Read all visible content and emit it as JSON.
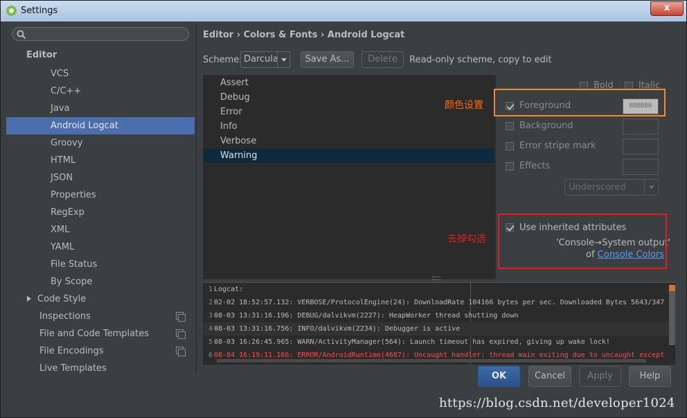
{
  "window": {
    "title": "Settings",
    "close_label": "x"
  },
  "sidebar": {
    "search_placeholder": "",
    "section": "Editor",
    "items": [
      {
        "label": "VCS"
      },
      {
        "label": "C/C++"
      },
      {
        "label": "Java"
      },
      {
        "label": "Android Logcat",
        "selected": true
      },
      {
        "label": "Groovy"
      },
      {
        "label": "HTML"
      },
      {
        "label": "JSON"
      },
      {
        "label": "Properties"
      },
      {
        "label": "RegExp"
      },
      {
        "label": "XML"
      },
      {
        "label": "YAML"
      },
      {
        "label": "File Status"
      },
      {
        "label": "By Scope"
      }
    ],
    "top_items": [
      {
        "label": "Code Style"
      },
      {
        "label": "Inspections"
      },
      {
        "label": "File and Code Templates"
      },
      {
        "label": "File Encodings"
      },
      {
        "label": "Live Templates"
      }
    ]
  },
  "breadcrumb": "Editor › Colors & Fonts › Android Logcat",
  "scheme": {
    "label": "Scheme:",
    "value": "Darcula",
    "save_as": "Save As...",
    "delete": "Delete",
    "note": "Read-only scheme, copy to edit"
  },
  "log_levels": [
    "Assert",
    "Debug",
    "Error",
    "Info",
    "Verbose",
    "Warning"
  ],
  "selected_level": "Warning",
  "attributes": {
    "bold": "Bold",
    "italic": "Italic",
    "foreground": "Foreground",
    "foreground_color": "BBBBBB",
    "background": "Background",
    "error_stripe": "Error stripe mark",
    "effects": "Effects",
    "effect_type": "Underscored",
    "use_inherited": "Use inherited attributes",
    "inherit_from": "'Console→System output'",
    "of": "of",
    "link": "Console Colors"
  },
  "annotations": {
    "color_setting": "颜色设置",
    "uncheck": "去掉勾选",
    "color": "#ff8c1a",
    "red": "#e02020"
  },
  "preview": [
    {
      "n": "1",
      "text": "Logcat:"
    },
    {
      "n": "2",
      "text": "02-02 18:52:57.132: VERBOSE/ProtocolEngine(24): DownloadRate 104166 bytes per sec. Downloaded Bytes 5643/347"
    },
    {
      "n": "3",
      "text": "08-03 13:31:16.196: DEBUG/dalvikvm(2227): HeapWorker thread shutting down"
    },
    {
      "n": "4",
      "text": "08-03 13:31:16.756: INFO/dalvikvm(2234): Debugger is active"
    },
    {
      "n": "5",
      "text": "08-03 16:26:45.965: WARN/ActivityManager(564): Launch timeout has expired, giving up wake lock!"
    },
    {
      "n": "6",
      "text": "08-04 16:19:11.166: ERROR/AndroidRuntime(4687): Uncaught handler: thread main exiting due to uncaught except"
    }
  ],
  "footer": {
    "ok": "OK",
    "cancel": "Cancel",
    "apply": "Apply",
    "help": "Help"
  },
  "watermark": "https://blog.csdn.net/developer1024"
}
